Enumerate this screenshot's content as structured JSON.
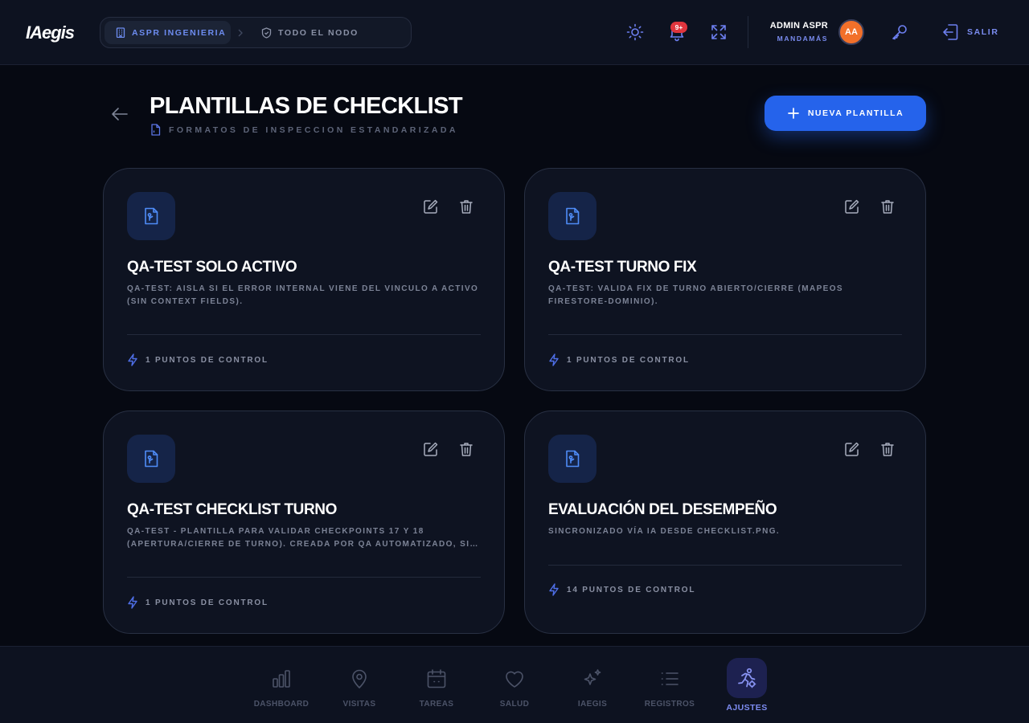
{
  "app": {
    "logo": "IAegis"
  },
  "header": {
    "breadcrumb": {
      "organization": "ASPR INGENIERIA",
      "scope": "TODO EL NODO"
    },
    "notifications_badge": "9+",
    "user": {
      "name": "ADMIN ASPR",
      "role": "MANDAMÁS",
      "initials": "AA"
    },
    "logout_label": "SALIR"
  },
  "page": {
    "title": "PLANTILLAS DE CHECKLIST",
    "subtitle": "FORMATOS DE INSPECCION ESTANDARIZADA",
    "new_button_label": "NUEVA PLANTILLA"
  },
  "templates": [
    {
      "title": "QA-TEST SOLO ACTIVO",
      "description": "QA-TEST: AISLA SI EL ERROR INTERNAL VIENE DEL VINCULO A ACTIVO (SIN CONTEXT FIELDS).",
      "checkpoints": "1 PUNTOS DE CONTROL"
    },
    {
      "title": "QA-TEST TURNO FIX",
      "description": "QA-TEST: VALIDA FIX DE TURNO ABIERTO/CIERRE (MAPEOS FIRESTORE-DOMINIO).",
      "checkpoints": "1 PUNTOS DE CONTROL"
    },
    {
      "title": "QA-TEST CHECKLIST TURNO",
      "description": "QA-TEST - PLANTILLA PARA VALIDAR CHECKPOINTS 17 Y 18 (APERTURA/CIERRE DE TURNO). CREADA POR QA AUTOMATIZADO, SIN IMPACTO EN PRODUCCIÓN.",
      "checkpoints": "1 PUNTOS DE CONTROL"
    },
    {
      "title": "EVALUACIÓN DEL DESEMPEÑO",
      "description": "SINCRONIZADO VÍA IA DESDE CHECKLIST.PNG.",
      "checkpoints": "14 PUNTOS DE CONTROL"
    }
  ],
  "bottom_nav": {
    "items": [
      {
        "label": "DASHBOARD",
        "icon": "bar-chart-icon"
      },
      {
        "label": "VISITAS",
        "icon": "map-pin-icon"
      },
      {
        "label": "TAREAS",
        "icon": "calendar-icon"
      },
      {
        "label": "SALUD",
        "icon": "heart-icon"
      },
      {
        "label": "IAEGIS",
        "icon": "sparkles-icon"
      },
      {
        "label": "REGISTROS",
        "icon": "list-icon"
      },
      {
        "label": "AJUSTES",
        "icon": "settings-running-icon"
      }
    ],
    "active": "AJUSTES"
  },
  "colors": {
    "background": "#060912",
    "surface": "#0e1321",
    "accent": "#2563eb",
    "accent_text": "#7a8cf0",
    "badge": "#e0353d",
    "avatar": "#f2702a"
  }
}
